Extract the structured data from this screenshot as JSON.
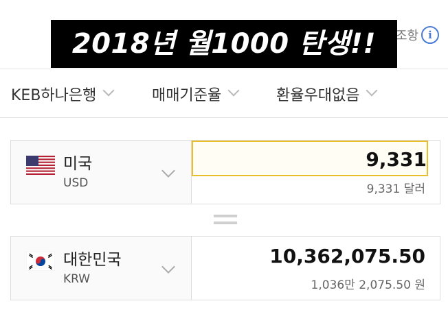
{
  "banner": {
    "text": "2018년 월1000 탄생!!"
  },
  "header": {
    "notice_partial": "조항",
    "info_icon": "info-icon"
  },
  "filters": [
    {
      "label": "KEB하나은행"
    },
    {
      "label": "매매기준율"
    },
    {
      "label": "환율우대없음"
    }
  ],
  "from": {
    "country": "미국",
    "code": "USD",
    "flag": "us-flag",
    "amount": "9,331",
    "amount_words": "9,331 달러"
  },
  "to": {
    "country": "대한민국",
    "code": "KRW",
    "flag": "kr-flag",
    "amount": "10,362,075.50",
    "amount_words": "1,036만 2,075.50 원"
  },
  "colors": {
    "input_border": "#e8bf2a",
    "info_blue": "#4a7bd4",
    "panel_border": "#dcdcdc"
  }
}
